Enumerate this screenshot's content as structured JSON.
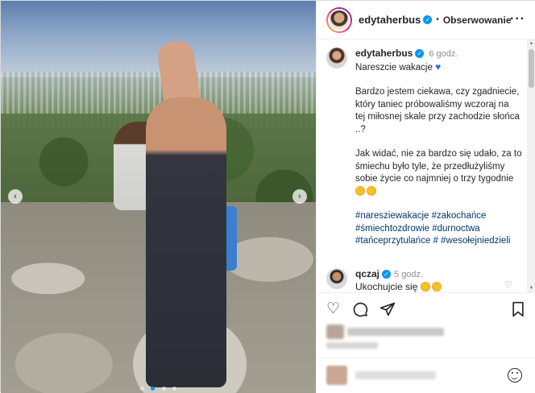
{
  "post": {
    "header": {
      "username": "edytaherbus",
      "separator": "•",
      "follow_label": "Obserwowanie",
      "more_icon": "more-horizontal-icon"
    },
    "caption": {
      "username": "edytaherbus",
      "time": "6 godz.",
      "lines": [
        "Nareszcie wakacje",
        "Bardzo jestem ciekawa, czy zgadniecie,",
        "który taniec próbowaliśmy wczoraj na",
        "tej miłosnej skale przy zachodzie słońca",
        "..?",
        "Jak widać, nie za bardzo się udało, za to",
        "śmiechu było tyle, że przedłużyliśmy",
        "sobie życie co najmniej o trzy tygodnie"
      ],
      "hashtags": [
        "#naresziewakacje #zakochańce",
        "#śmiechtozdrowie #durnoctwa",
        "#tańceprzytulańce # #wesołejniedzieli"
      ]
    },
    "comment": {
      "username": "qczaj",
      "time": "5 godz.",
      "text": "Ukochujcie się"
    },
    "actions": {
      "like_icon": "heart-icon",
      "comment_icon": "comment-icon",
      "share_icon": "send-icon",
      "save_icon": "bookmark-icon"
    },
    "photo": {
      "prev_icon": "chevron-left-icon",
      "next_icon": "chevron-right-icon",
      "slides": 4,
      "active_slide": 2
    },
    "colors": {
      "accent": "#0095f6",
      "hashtag": "#00376b",
      "muted": "#8e8e8e"
    }
  }
}
